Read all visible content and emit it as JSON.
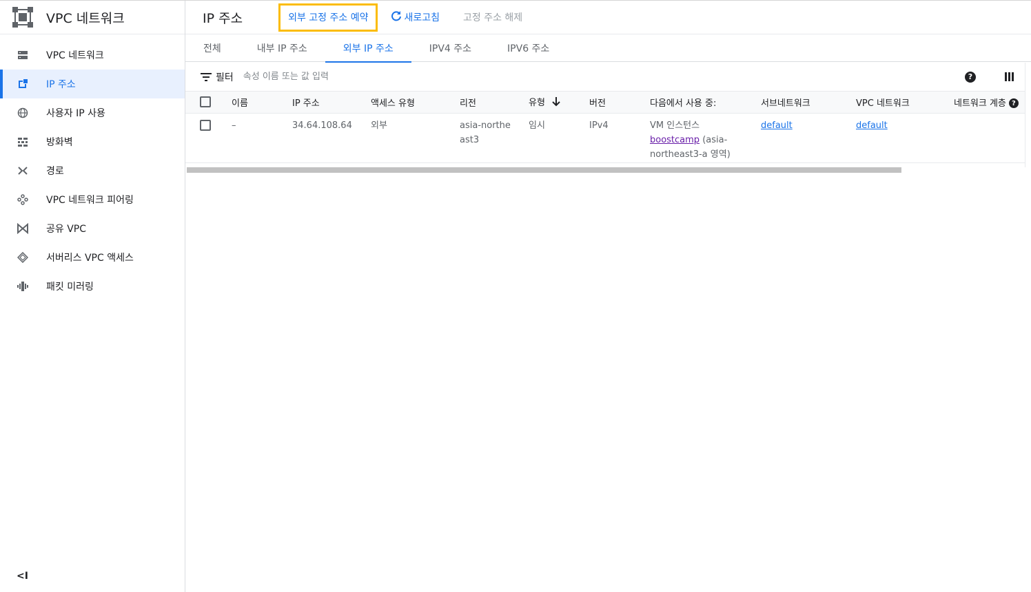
{
  "sidebar": {
    "title": "VPC 네트워크",
    "items": [
      {
        "label": "VPC 네트워크",
        "icon": "vpc-network-icon"
      },
      {
        "label": "IP 주소",
        "icon": "ip-address-icon",
        "active": true
      },
      {
        "label": "사용자 IP 사용",
        "icon": "globe-icon"
      },
      {
        "label": "방화벽",
        "icon": "firewall-icon"
      },
      {
        "label": "경로",
        "icon": "routes-icon"
      },
      {
        "label": "VPC 네트워크 피어링",
        "icon": "peering-icon"
      },
      {
        "label": "공유 VPC",
        "icon": "shared-vpc-icon"
      },
      {
        "label": "서버리스 VPC 액세스",
        "icon": "serverless-icon"
      },
      {
        "label": "패킷 미러링",
        "icon": "packet-mirroring-icon"
      }
    ],
    "collapse_label": "<I"
  },
  "header": {
    "title": "IP 주소",
    "actions": {
      "reserve": "외부 고정 주소 예약",
      "refresh": "새로고침",
      "release": "고정 주소 해제"
    }
  },
  "tabs": [
    {
      "label": "전체"
    },
    {
      "label": "내부 IP 주소"
    },
    {
      "label": "외부 IP 주소",
      "active": true
    },
    {
      "label": "IPV4 주소"
    },
    {
      "label": "IPV6 주소"
    }
  ],
  "filter": {
    "label": "필터",
    "placeholder": "속성 이름 또는 값 입력"
  },
  "table": {
    "columns": [
      "이름",
      "IP 주소",
      "액세스 유형",
      "리전",
      "유형",
      "버전",
      "다음에서 사용 중:",
      "서브네트워크",
      "VPC 네트워크",
      "네트워크 계층"
    ],
    "rows": [
      {
        "name": "–",
        "ip": "34.64.108.64",
        "access": "외부",
        "region": "asia-northeast3",
        "type": "임시",
        "version": "IPv4",
        "used_by_prefix": "VM 인스턴스",
        "used_by_link": "boostcamp",
        "used_by_suffix": "(asia-northeast3-a 영역)",
        "subnet": "default",
        "vpc": "default"
      }
    ]
  },
  "colors": {
    "accent": "#1a73e8",
    "highlight": "#fbbc04",
    "visited_link": "#681da8"
  }
}
